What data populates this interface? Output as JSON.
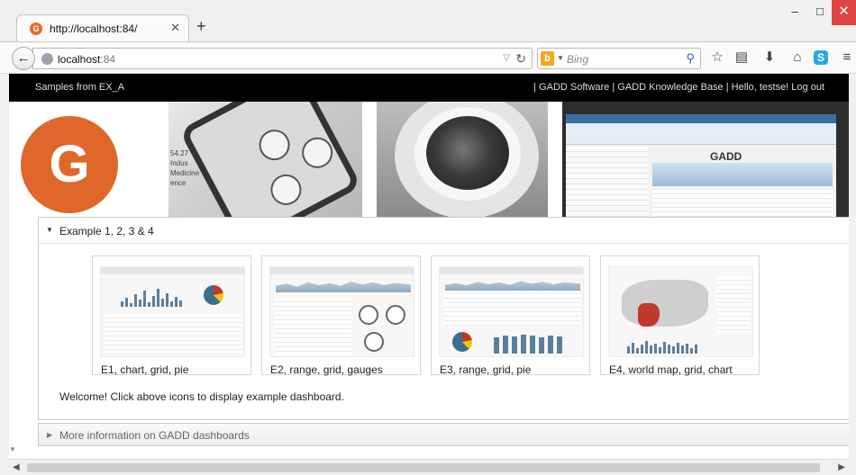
{
  "browser": {
    "tab_title": "http://localhost:84/",
    "tab_favicon_letter": "G",
    "new_tab_label": "+",
    "url_host": "localhost",
    "url_port": ":84",
    "search_engine_letter": "b",
    "search_placeholder": "Bing",
    "window_buttons": {
      "minimize": "–",
      "maximize": "□",
      "close": "✕"
    }
  },
  "site": {
    "nav_left": "Samples from EX_A",
    "nav_right": {
      "sep1": "| ",
      "gadd_software": "GADD Software",
      "sep2": " | ",
      "knowledge_base": "GADD Knowledge Base",
      "sep3": " | Hello, testse! ",
      "logout": "Log out"
    },
    "logo_letter": "G",
    "banner_photo1_text": "54.27\nIndus\nMedicine\nence",
    "banner_photo3_text": "GADD"
  },
  "accordion": {
    "section1_title": "Example 1, 2, 3 & 4",
    "examples": [
      {
        "caption": "E1, chart, grid, pie"
      },
      {
        "caption": "E2, range, grid, gauges"
      },
      {
        "caption": "E3, range, grid, pie"
      },
      {
        "caption": "E4, world map, grid, chart"
      }
    ],
    "welcome_text": "Welcome! Click above icons to display example dashboard.",
    "section2_title": "More information on GADD dashboards"
  },
  "colors": {
    "brand_orange": "#e0672a",
    "nav_black": "#000000",
    "close_red": "#e04343"
  },
  "icons": [
    "back-arrow-icon",
    "globe-icon",
    "reload-icon",
    "search-icon",
    "star-icon",
    "reading-list-icon",
    "download-icon",
    "home-icon",
    "skype-icon",
    "menu-icon"
  ]
}
